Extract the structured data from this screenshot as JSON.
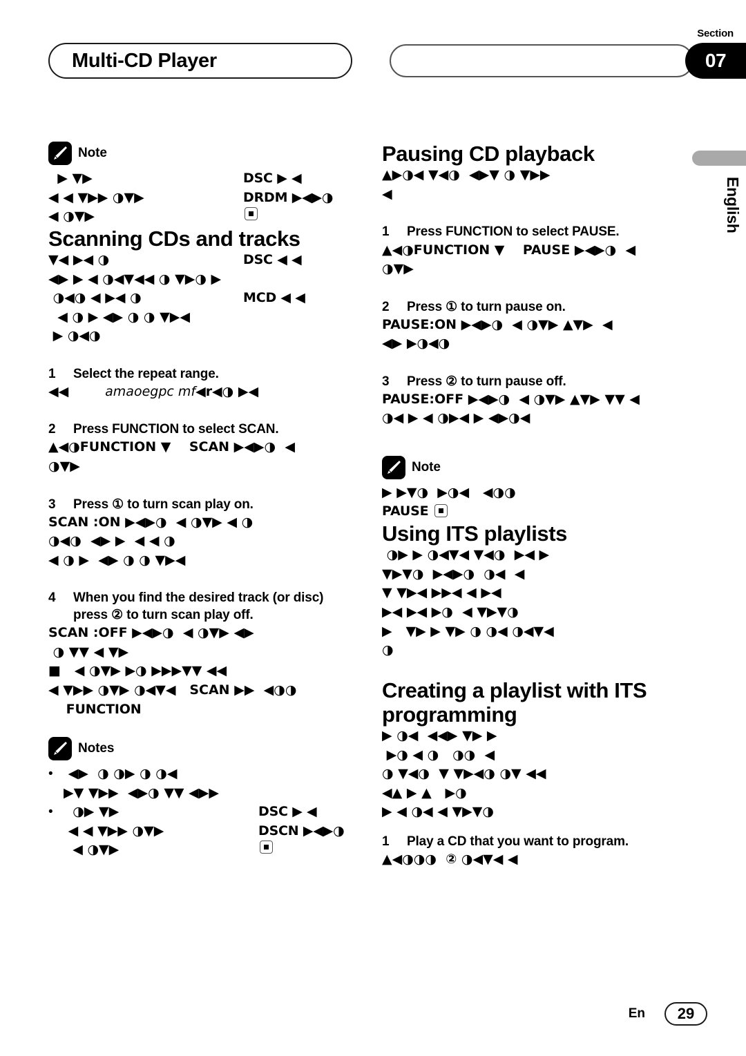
{
  "header": {
    "title": "Multi-CD Player",
    "section_label": "Section",
    "section_number": "07",
    "empty_pill": ""
  },
  "language_tab": {
    "label": "English"
  },
  "footer": {
    "lang_code": "En",
    "page_number": "29"
  },
  "left_column": {
    "note_top": {
      "label": "Note",
      "lines": [
        {
          "left": "  ▶ ▼▶",
          "right": "DSC ▶ ◀"
        },
        {
          "left": "◀ ◀ ▼▶▶ ◑▼▶",
          "right": "DRDM ▶◀▶◑"
        },
        {
          "left": "◀ ◑▼▶",
          "right": ""
        }
      ],
      "last_line_has_box_icon": true
    },
    "heading_scanning": "Scanning CDs and tracks",
    "scanning_intro": [
      {
        "left": "▼◀ ▶◀ ◑",
        "right": "DSC ◀ ◀"
      },
      {
        "left": "◀▶ ▶ ◀ ◑◀▼◀◀ ◑ ▼▶◑ ▶",
        "right": ""
      },
      {
        "left": " ◑◀◑ ◀ ▶◀ ◑",
        "right": "MCD ◀ ◀"
      },
      {
        "left": "  ◀ ◑ ▶ ◀▶ ◑ ◑ ▼▶◀",
        "right": ""
      },
      {
        "left": " ▶ ◑◀◑",
        "right": ""
      }
    ],
    "steps": [
      {
        "num": "1",
        "text": "Select the repeat range.",
        "body_pre": "◀◀",
        "body_italic": "amaoegpc mf",
        "body_post": "◀r◀◑ ▶◀"
      },
      {
        "num": "2",
        "text": "Press FUNCTION to select SCAN.",
        "lines": [
          "▲◀◑FUNCTION ▼    SCAN ▶◀▶◑  ◀",
          "◑▼▶"
        ]
      },
      {
        "num": "3",
        "text": "Press ① to turn scan play on.",
        "lines": [
          "SCAN :ON ▶◀▶◑  ◀ ◑▼▶ ◀ ◑",
          "◑◀◑  ◀▶ ▶  ◀ ◀ ◑",
          "◀ ◑ ▶  ◀▶ ◑ ◑ ▼▶◀"
        ]
      },
      {
        "num": "4",
        "text": "When you find the desired track (or disc) press ② to turn scan play off.",
        "lines": [
          "SCAN :OFF ▶◀▶◑  ◀ ◑▼▶ ◀▶",
          " ◑ ▼▼ ◀ ▼▶"
        ],
        "sub_bullet": "■   ◀ ◑▼▶ ▶◑ ▶▶▶▼▼ ◀◀",
        "last_lines": [
          "◀ ▼▶▶ ◑▼▶ ◑◀▼◀   SCAN ▶▶  ◀◑◑",
          "    FUNCTION"
        ]
      }
    ],
    "notes_bottom": {
      "label": "Notes",
      "bullets": [
        {
          "lines": [
            {
              "left": " ◀▶  ◑ ◑▶ ◑ ◑◀",
              "right": ""
            },
            {
              "left": "▶▼ ▼▶▶  ◀▶◑ ▼▼ ◀▶▶",
              "right": ""
            }
          ]
        },
        {
          "lines": [
            {
              "left": "  ◑▶ ▼▶",
              "right": "DSC ▶ ◀"
            },
            {
              "left": " ◀ ◀ ▼▶▶ ◑▼▶",
              "right": "DSCN ▶◀▶◑"
            },
            {
              "left": "  ◀ ◑▼▶",
              "right": ""
            }
          ],
          "last_line_has_box_icon": true
        }
      ]
    }
  },
  "right_column": {
    "heading_pausing": "Pausing CD playback",
    "pausing_intro": [
      "▲▶◑◀ ▼◀◑  ◀▶▼ ◑ ▼▶▶",
      "◀"
    ],
    "steps": [
      {
        "num": "1",
        "text": "Press FUNCTION to select PAUSE.",
        "lines": [
          "▲◀◑FUNCTION ▼    PAUSE ▶◀▶◑  ◀",
          "◑▼▶"
        ]
      },
      {
        "num": "2",
        "text": "Press ① to turn pause on.",
        "lines": [
          "PAUSE:ON ▶◀▶◑  ◀ ◑▼▶ ▲▼▶  ◀",
          "◀▶ ▶◑◀◑"
        ]
      },
      {
        "num": "3",
        "text": "Press ② to turn pause off.",
        "lines": [
          "PAUSE:OFF ▶◀▶◑  ◀ ◑▼▶ ▲▼▶ ▼▼ ◀",
          "◑◀ ▶ ◀ ◑▶◀ ▶ ◀▶◑◀"
        ]
      }
    ],
    "note": {
      "label": "Note",
      "lines": [
        "▶ ▶▼◑  ▶◑◀   ◀◑◑",
        "PAUSE"
      ],
      "last_line_has_box_icon": true
    },
    "heading_its": "Using ITS playlists",
    "its_intro": [
      " ◑▶ ▶ ◑◀▼◀ ▼◀◑  ▶◀ ▶",
      "▼▶▼◑  ▶◀▶◑  ◑◀  ◀",
      "▼ ▼▶◀ ▶▶◀ ◀ ▶◀",
      "▶◀ ▶◀ ▶◑  ◀ ▼▶▼◑",
      "▶   ▼▶ ▶ ▼▶ ◑ ◑◀ ◑◀▼◀",
      "◑"
    ],
    "heading_creating": "Creating a playlist with ITS programming",
    "creating_intro": [
      "▶ ◑◀  ◀◀▶ ▼▶ ▶",
      " ▶◑ ◀ ◑   ◑◑  ◀",
      "◑ ▼◀◑  ▼ ▼▶◀◑ ◑▼ ◀◀",
      "◀▲ ▶ ▲   ▶◑",
      "▶ ◀ ◑◀ ◀ ▼▶▼◑"
    ],
    "final_step": {
      "num": "1",
      "text": "Play a CD that you want to program.",
      "line": "▲◀◑◑◑  ② ◑◀▼◀ ◀"
    }
  }
}
